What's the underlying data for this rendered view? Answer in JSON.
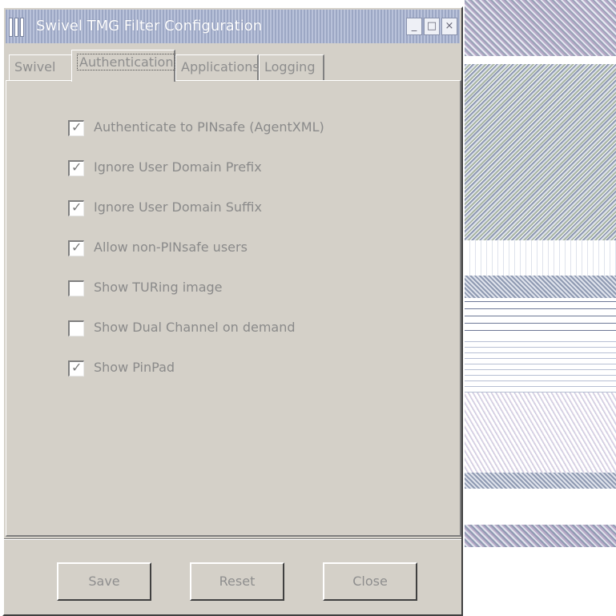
{
  "window": {
    "title": "Swivel TMG Filter Configuration",
    "minimize_glyph": "_",
    "maximize_glyph": "□",
    "close_glyph": "×"
  },
  "tabs": [
    {
      "label": "Swivel",
      "active": false
    },
    {
      "label": "Authentication",
      "active": true
    },
    {
      "label": "Applications",
      "active": false
    },
    {
      "label": "Logging",
      "active": false
    }
  ],
  "options": [
    {
      "label": "Authenticate to PINsafe (AgentXML)",
      "checked": true
    },
    {
      "label": "Ignore User Domain Prefix",
      "checked": true
    },
    {
      "label": "Ignore User Domain Suffix",
      "checked": true
    },
    {
      "label": "Allow non-PINsafe users",
      "checked": true
    },
    {
      "label": "Show TURing image",
      "checked": false
    },
    {
      "label": "Show Dual Channel on demand",
      "checked": false
    },
    {
      "label": "Show PinPad",
      "checked": true
    }
  ],
  "buttons": {
    "save": "Save",
    "reset": "Reset",
    "close": "Close"
  },
  "colors": {
    "dialog_face": "#d4d0c8",
    "title_bar": "#b9c2da",
    "text": "#8e8e8e"
  }
}
